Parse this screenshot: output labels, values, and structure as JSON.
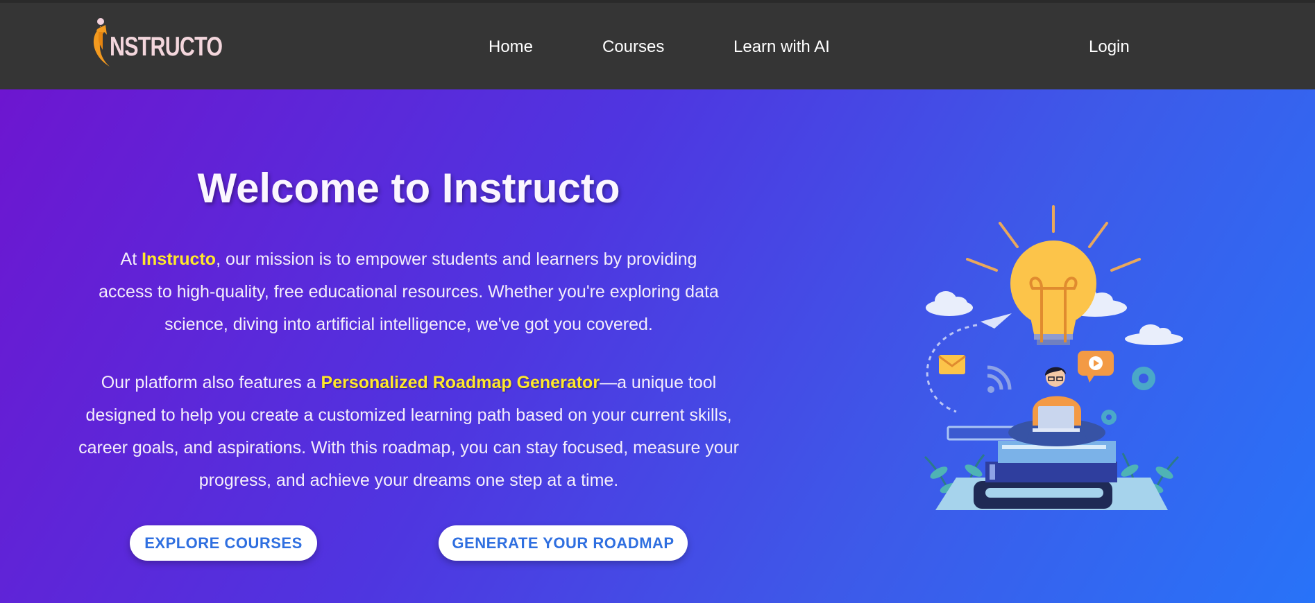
{
  "nav": {
    "logo_text": "NSTRUCTO",
    "links": [
      "Home",
      "Courses",
      "Learn with AI"
    ],
    "login": "Login"
  },
  "hero": {
    "title": "Welcome to Instructo",
    "p1_before": "At ",
    "p1_highlight": "Instructo",
    "p1_after": ", our mission is to empower students and learners by providing access to high-quality, free educational resources. Whether you're exploring data science, diving into artificial intelligence, we've got you covered.",
    "p2_before": "Our platform also features a ",
    "p2_highlight": "Personalized Roadmap Generator",
    "p2_after": "—a unique tool designed to help you create a customized learning path based on your current skills, career goals, and aspirations. With this roadmap, you can stay focused, measure your progress, and achieve your dreams one step at a time.",
    "buttons": {
      "explore": "EXPLORE COURSES",
      "roadmap": "GENERATE YOUR ROADMAP"
    }
  },
  "colors": {
    "nav_bg": "#353535",
    "gradient_start": "#6d16d0",
    "gradient_end": "#2873f8",
    "highlight": "#ffe82a",
    "button_text": "#2f6fe0",
    "logo_accent": "#f39a1f"
  },
  "icons": {
    "logo": "instructo-logo-icon",
    "illustration": "learner-lightbulb-illustration"
  }
}
